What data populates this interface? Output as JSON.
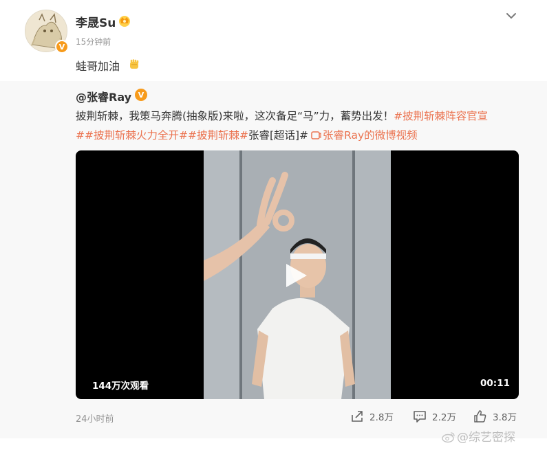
{
  "post": {
    "user_name": "李晟Su",
    "time": "15分钟前",
    "text": "蛙哥加油",
    "more_icon": "chevron-down-icon",
    "crown_icon": "crown-icon",
    "emoji_icon": "fist-icon"
  },
  "repost": {
    "author": "@张睿Ray",
    "line1_text": "披荆斩棘，我策马奔腾(抽象版)来啦，这次备足“马”力，蓄势出发！",
    "line1_tag": "#披荆斩棘阵容官宣",
    "line2_tag1": "##披荆斩棘火力全开##披荆斩棘#",
    "line2_text": "张睿[超话]#",
    "line2_link": "张睿Ray的微博视频",
    "video": {
      "views": "144万次观看",
      "duration": "00:11"
    },
    "time": "24小时前",
    "actions": {
      "share": "2.8万",
      "comment": "2.2万",
      "like": "3.8万"
    }
  },
  "watermark": "@综艺密探",
  "colors": {
    "tag": "#eb7350",
    "verified": "#f79b1c",
    "repost_bg": "#f8f8f8"
  }
}
